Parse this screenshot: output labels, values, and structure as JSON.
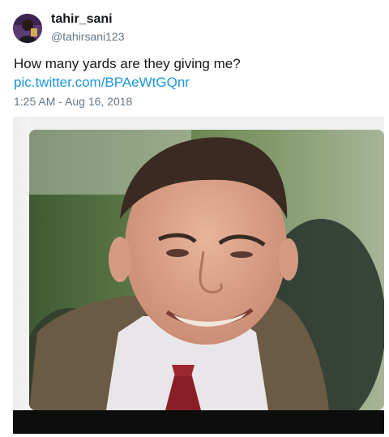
{
  "tweet": {
    "display_name": "tahir_sani",
    "username": "@tahirsani123",
    "text": "How many yards are they giving me?",
    "link": "pic.twitter.com/BPAeWtGQnr",
    "timestamp": "1:25 AM - Aug 16, 2018"
  },
  "colors": {
    "link": "#1b95e0",
    "secondary_text": "#657786",
    "primary_text": "#14171a"
  }
}
